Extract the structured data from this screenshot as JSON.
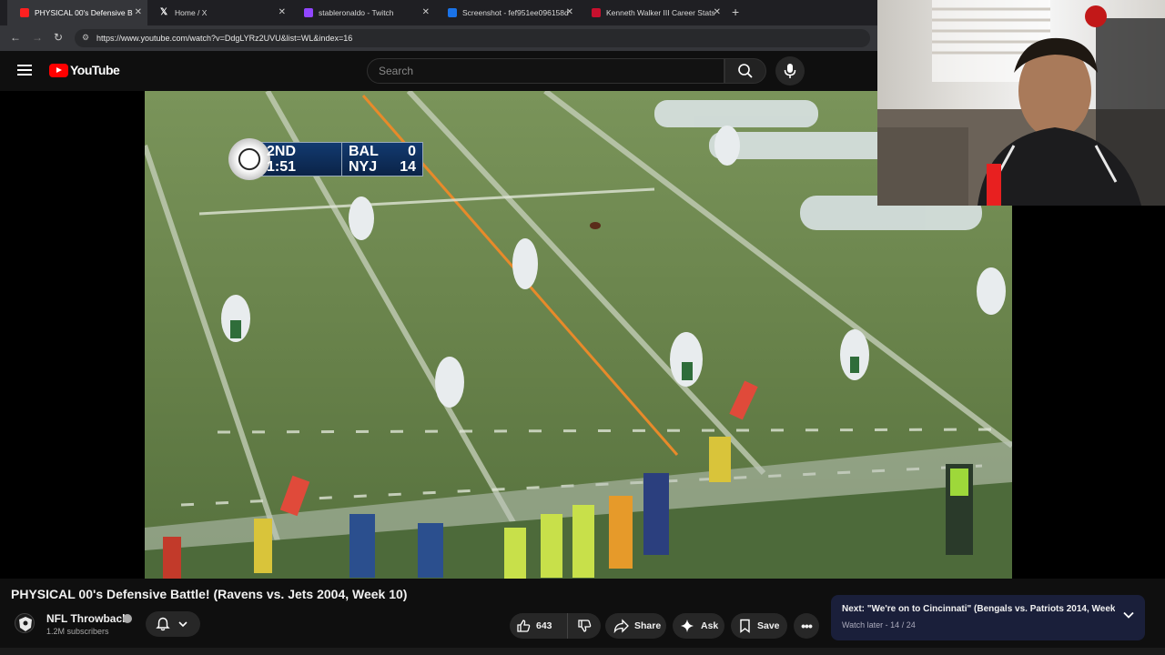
{
  "browser": {
    "tabs": [
      {
        "label": "PHYSICAL 00's Defensive B",
        "fav_color": "#ff2020",
        "active": true
      },
      {
        "label": "Home / X",
        "fav_color": "#ffffff",
        "active": false
      },
      {
        "label": "stableronaldo - Twitch",
        "fav_color": "#9146ff",
        "active": false
      },
      {
        "label": "Screenshot - fef951ee096158d",
        "fav_color": "#1a73e8",
        "active": false
      },
      {
        "label": "Kenneth Walker III Career Stats",
        "fav_color": "#c8102e",
        "active": false
      }
    ],
    "url": "https://www.youtube.com/watch?v=DdgLYRz2UVU&list=WL&index=16"
  },
  "header": {
    "logo_text": "YouTube",
    "search_placeholder": "Search"
  },
  "scorebug": {
    "quarter": "2ND",
    "clock": "1:51",
    "team1": "BAL",
    "score1": "0",
    "team2": "NYJ",
    "score2": "14"
  },
  "video": {
    "title": "PHYSICAL 00's Defensive Battle! (Ravens vs. Jets 2004, Week 10)"
  },
  "channel": {
    "name": "NFL Throwback",
    "subscribers": "1.2M subscribers"
  },
  "actions": {
    "likes": "643",
    "share": "Share",
    "ask": "Ask",
    "save": "Save"
  },
  "next": {
    "label": "Next: \"We're on to Cincinnati\" (Bengals vs. Patriots 2014, Week ...",
    "sub": "Watch later - 14 / 24"
  },
  "colors": {
    "accent": "#ff0000",
    "background": "#0f0f0f"
  }
}
